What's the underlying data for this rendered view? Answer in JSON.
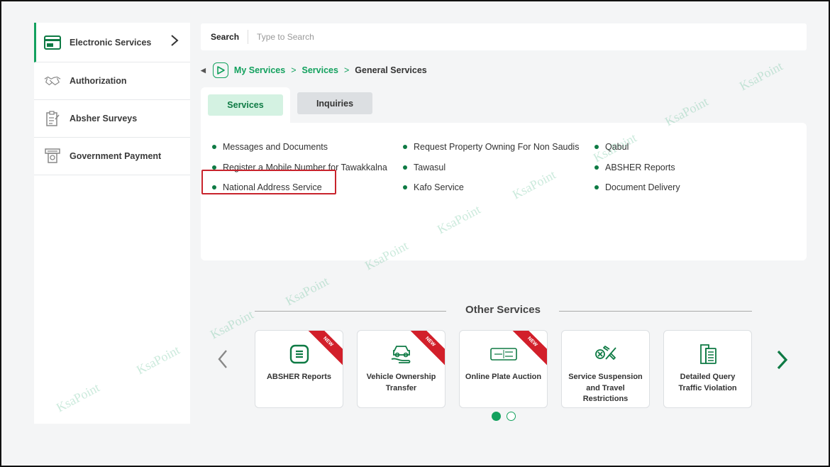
{
  "sidebar": {
    "items": [
      {
        "label": "Electronic Services",
        "icon": "card-window-icon",
        "active": true
      },
      {
        "label": "Authorization",
        "icon": "handshake-icon"
      },
      {
        "label": "Absher Surveys",
        "icon": "survey-icon"
      },
      {
        "label": "Government Payment",
        "icon": "atm-payment-icon"
      }
    ]
  },
  "search": {
    "label": "Search",
    "placeholder": "Type to Search"
  },
  "breadcrumb": {
    "items": [
      "My Services",
      "Services",
      "General Services"
    ],
    "separator": ">"
  },
  "tabs": [
    {
      "label": "Services",
      "active": true
    },
    {
      "label": "Inquiries"
    }
  ],
  "services": {
    "col1": [
      "Messages and Documents",
      "Register a Mobile Number for Tawakkalna",
      "National Address Service"
    ],
    "col2": [
      "Request Property Owning For Non Saudis",
      "Tawasul",
      "Kafo Service"
    ],
    "col3": [
      "Qabul",
      "ABSHER Reports",
      "Document Delivery"
    ]
  },
  "other_services": {
    "title": "Other Services",
    "cards": [
      {
        "label": "ABSHER Reports",
        "badge": "NEW",
        "icon": "report-icon"
      },
      {
        "label": "Vehicle Ownership Transfer",
        "badge": "NEW",
        "icon": "car-hand-icon"
      },
      {
        "label": "Online Plate Auction",
        "badge": "NEW",
        "icon": "plate-icon"
      },
      {
        "label": "Service Suspension and Travel Restrictions",
        "badge": "",
        "icon": "plane-blocked-icon"
      },
      {
        "label": "Detailed Query Traffic Violation",
        "badge": "",
        "icon": "document-stack-icon"
      }
    ],
    "pages": 2,
    "current_page": 1
  },
  "watermark": "KsaPoint",
  "colors": {
    "brand_green": "#13a15e",
    "dark_green": "#0e7a44",
    "highlight_red": "#c8232c",
    "badge_red": "#d21f2a"
  }
}
